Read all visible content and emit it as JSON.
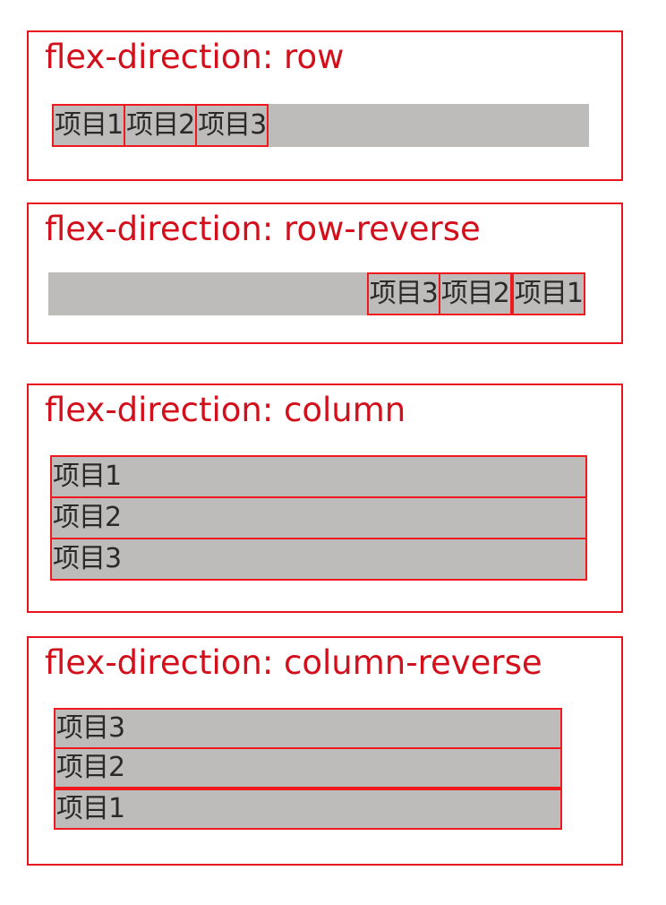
{
  "panels": [
    {
      "title": "flex-direction: row",
      "items": [
        "项目1",
        "项目2",
        "项目3"
      ]
    },
    {
      "title": "flex-direction: row-reverse",
      "items": [
        "项目1",
        "项目2",
        "项目3"
      ]
    },
    {
      "title": "flex-direction: column",
      "items": [
        "项目1",
        "项目2",
        "项目3"
      ]
    },
    {
      "title": "flex-direction: column-reverse",
      "items": [
        "项目1",
        "项目2",
        "项目3"
      ]
    }
  ],
  "colors": {
    "border": "#e8141e",
    "title": "#d20f1b",
    "container_bg": "#bdbcbb",
    "item_text": "#2a2a2a"
  }
}
